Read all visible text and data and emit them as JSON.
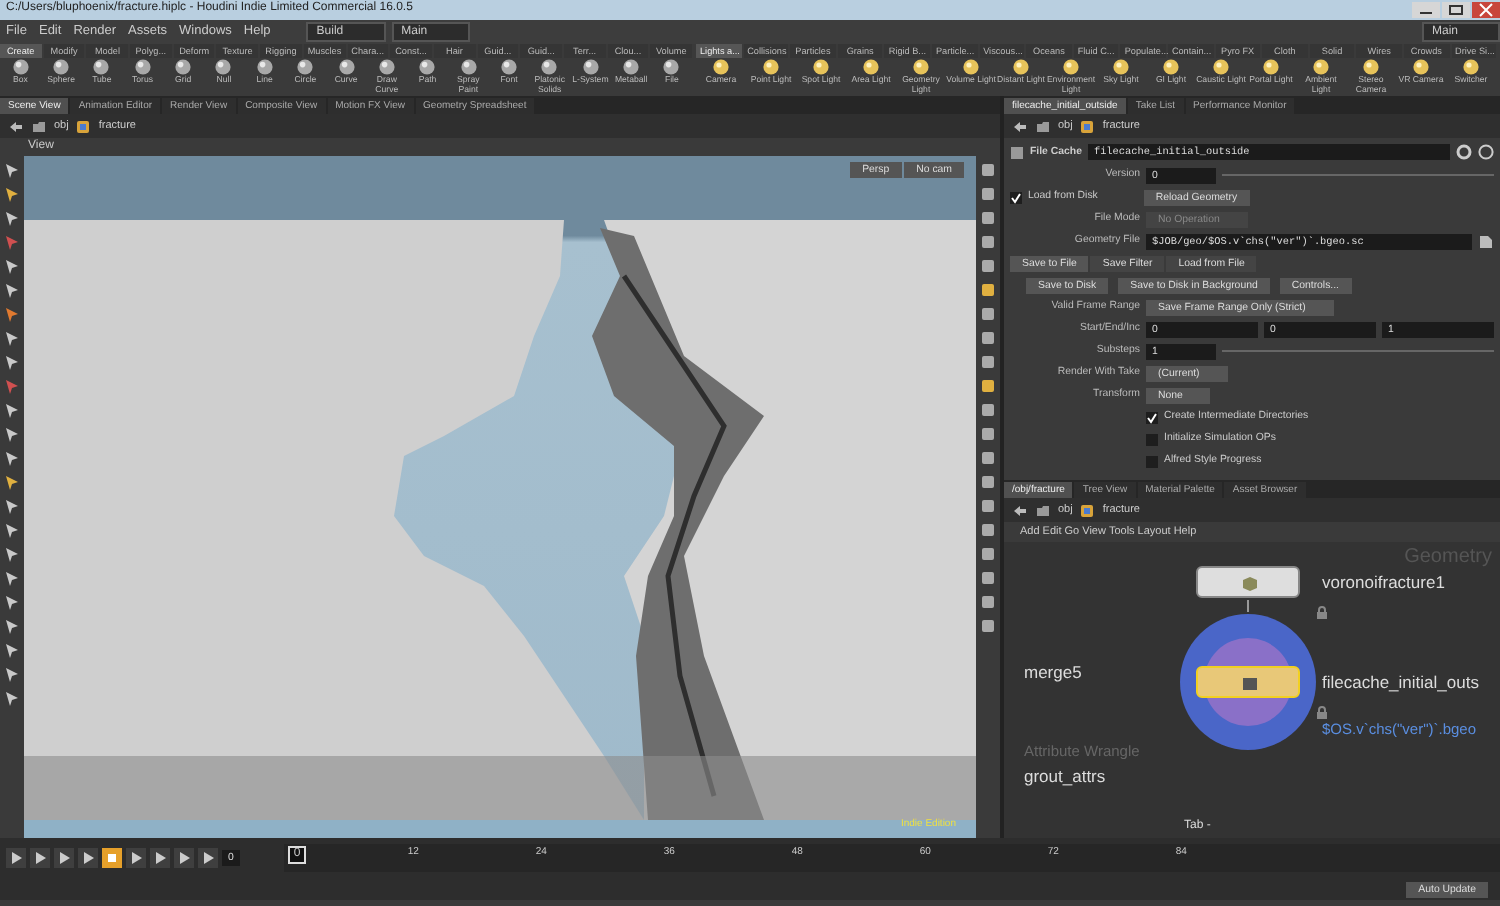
{
  "window": {
    "title": "C:/Users/bluphoenix/fracture.hiplc - Houdini Indie Limited Commercial 16.0.5"
  },
  "menu": [
    "File",
    "Edit",
    "Render",
    "Assets",
    "Windows",
    "Help"
  ],
  "desktop": "Build",
  "workspace": "Main",
  "right_workspace": "Main",
  "shelf_left": {
    "tabs": [
      {
        "label": "Create",
        "selected": true
      },
      {
        "label": "Modify",
        "selected": false
      },
      {
        "label": "Model",
        "selected": false
      },
      {
        "label": "Polyg...",
        "selected": false
      },
      {
        "label": "Deform",
        "selected": false
      },
      {
        "label": "Texture",
        "selected": false
      },
      {
        "label": "Rigging",
        "selected": false
      },
      {
        "label": "Muscles",
        "selected": false
      },
      {
        "label": "Chara...",
        "selected": false
      },
      {
        "label": "Const...",
        "selected": false
      },
      {
        "label": "Hair",
        "selected": false
      },
      {
        "label": "Guid...",
        "selected": false
      },
      {
        "label": "Guid...",
        "selected": false
      },
      {
        "label": "Terr...",
        "selected": false
      },
      {
        "label": "Clou...",
        "selected": false
      },
      {
        "label": "Volume",
        "selected": false
      }
    ],
    "tools": [
      "Box",
      "Sphere",
      "Tube",
      "Torus",
      "Grid",
      "Null",
      "Line",
      "Circle",
      "Curve",
      "Draw Curve",
      "Path",
      "Spray Paint",
      "Font",
      "Platonic Solids",
      "L-System",
      "Metaball",
      "File"
    ]
  },
  "shelf_right": {
    "tabs": [
      {
        "label": "Lights a...",
        "selected": true
      },
      {
        "label": "Collisions",
        "selected": false
      },
      {
        "label": "Particles",
        "selected": false
      },
      {
        "label": "Grains",
        "selected": false
      },
      {
        "label": "Rigid B...",
        "selected": false
      },
      {
        "label": "Particle...",
        "selected": false
      },
      {
        "label": "Viscous...",
        "selected": false
      },
      {
        "label": "Oceans",
        "selected": false
      },
      {
        "label": "Fluid C...",
        "selected": false
      },
      {
        "label": "Populate...",
        "selected": false
      },
      {
        "label": "Contain...",
        "selected": false
      },
      {
        "label": "Pyro FX",
        "selected": false
      },
      {
        "label": "Cloth",
        "selected": false
      },
      {
        "label": "Solid",
        "selected": false
      },
      {
        "label": "Wires",
        "selected": false
      },
      {
        "label": "Crowds",
        "selected": false
      },
      {
        "label": "Drive Si...",
        "selected": false
      }
    ],
    "tools": [
      "Camera",
      "Point Light",
      "Spot Light",
      "Area Light",
      "Geometry Light",
      "Volume Light",
      "Distant Light",
      "Environment Light",
      "Sky Light",
      "GI Light",
      "Caustic Light",
      "Portal Light",
      "Ambient Light",
      "Stereo Camera",
      "VR Camera",
      "Switcher"
    ]
  },
  "left_pane": {
    "tabs": [
      {
        "label": "Scene View",
        "selected": true
      },
      {
        "label": "Animation Editor",
        "selected": false
      },
      {
        "label": "Render View",
        "selected": false
      },
      {
        "label": "Composite View",
        "selected": false
      },
      {
        "label": "Motion FX View",
        "selected": false
      },
      {
        "label": "Geometry Spreadsheet",
        "selected": false
      }
    ],
    "path": [
      "obj",
      "fracture"
    ],
    "view_title": "View",
    "camera": "Persp",
    "cam_menu": "No cam",
    "edition": "Indie Edition"
  },
  "right_pane": {
    "tabs": [
      {
        "label": "filecache_initial_outside",
        "selected": true
      },
      {
        "label": "Take List",
        "selected": false
      },
      {
        "label": "Performance Monitor",
        "selected": false
      }
    ],
    "path": [
      "obj",
      "fracture"
    ],
    "node_type": "File Cache",
    "node_name": "filecache_initial_outside",
    "rows": [
      {
        "kind": "number",
        "label": "Version",
        "value": "0"
      },
      {
        "kind": "toggle_button",
        "label": "Load from Disk",
        "checked": true,
        "button": "Reload Geometry"
      },
      {
        "kind": "menu",
        "label": "File Mode",
        "value": "No Operation",
        "disabled": true
      },
      {
        "kind": "file",
        "label": "Geometry File",
        "value": "$JOB/geo/$OS.v`chs(\"ver\")`.bgeo.sc"
      },
      {
        "kind": "tabs",
        "tabs": [
          {
            "label": "Save to File",
            "selected": true
          },
          {
            "label": "Save Filter",
            "selected": false
          },
          {
            "label": "Load from File",
            "selected": false
          }
        ]
      },
      {
        "kind": "buttons",
        "buttons": [
          "Save to Disk",
          "Save to Disk in Background",
          "Controls..."
        ]
      },
      {
        "kind": "menu",
        "label": "Valid Frame Range",
        "value": "Save Frame Range Only (Strict)",
        "disabled": false
      },
      {
        "kind": "vector",
        "label": "Start/End/Inc",
        "values": [
          "0",
          "0",
          "1"
        ]
      },
      {
        "kind": "number",
        "label": "Substeps",
        "value": "1"
      },
      {
        "kind": "menu",
        "label": "Render With Take",
        "value": "(Current)",
        "disabled": false
      },
      {
        "kind": "menu",
        "label": "Transform",
        "value": "None",
        "disabled": false
      },
      {
        "kind": "checkbox",
        "label": "Create Intermediate Directories",
        "checked": true
      },
      {
        "kind": "checkbox",
        "label": "Initialize Simulation OPs",
        "checked": false
      },
      {
        "kind": "checkbox",
        "label": "Alfred Style Progress",
        "checked": false
      }
    ]
  },
  "network_pane": {
    "tabs": [
      {
        "label": "/obj/fracture",
        "selected": true
      },
      {
        "label": "Tree View",
        "selected": false
      },
      {
        "label": "Material Palette",
        "selected": false
      },
      {
        "label": "Asset Browser",
        "selected": false
      }
    ],
    "path": [
      "obj",
      "fracture"
    ],
    "menu": [
      "Add",
      "Edit",
      "Go",
      "View",
      "Tools",
      "Layout",
      "Help"
    ],
    "context": "Geometry",
    "nodes": [
      {
        "kind": "sop",
        "label": "voronoifracture1",
        "selected": false
      },
      {
        "kind": "offscreen",
        "label": "merge5"
      },
      {
        "kind": "cache",
        "label": "filecache_initial_outs",
        "selected": true,
        "comment": "$OS.v`chs(\"ver\")`.bgeo"
      },
      {
        "kind": "offscreen",
        "type_label": "Attribute Wrangle",
        "label": "grout_attrs"
      }
    ],
    "hint": "Tab -"
  },
  "timeline": {
    "frame_field": "0",
    "current_frame": "0",
    "ticks": [
      "12",
      "24",
      "36",
      "48",
      "60",
      "72",
      "84"
    ]
  },
  "status_bar": {
    "button": "Auto Update"
  }
}
